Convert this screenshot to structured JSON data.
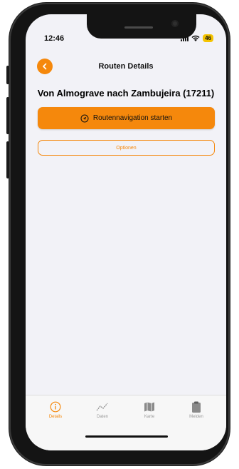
{
  "status_bar": {
    "time": "12:46",
    "battery": "46"
  },
  "navigation": {
    "title": "Routen Details",
    "back_icon": "chevron-left-icon"
  },
  "route": {
    "title": "Von Almograve nach Zambujeira (17211)"
  },
  "actions": {
    "start_navigation_label": "Routennavigation starten",
    "start_navigation_icon": "navigation-arrow-icon",
    "options_label": "Optionen"
  },
  "tabs": [
    {
      "label": "Details",
      "icon": "info-icon",
      "active": true
    },
    {
      "label": "Daten",
      "icon": "chart-line-icon",
      "active": false
    },
    {
      "label": "Karte",
      "icon": "map-icon",
      "active": false
    },
    {
      "label": "Melden",
      "icon": "clipboard-icon",
      "active": false
    }
  ],
  "colors": {
    "accent": "#f5880c",
    "background": "#f2f2f7",
    "battery": "#f5c400"
  }
}
